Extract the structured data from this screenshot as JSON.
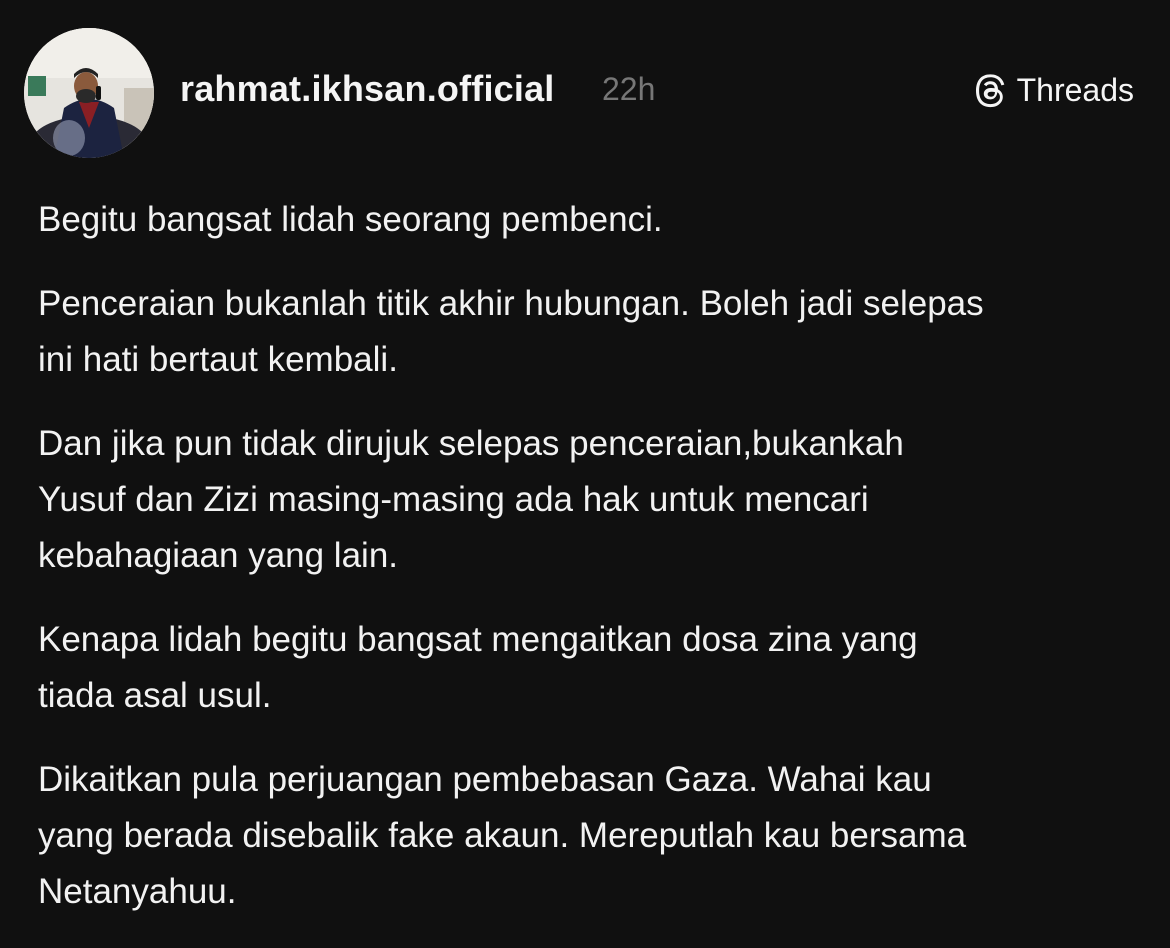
{
  "author": {
    "username": "rahmat.ikhsan.official",
    "timestamp": "22h",
    "avatar_alt": "avatar"
  },
  "platform": {
    "label": "Threads",
    "icon": "threads-logo-icon"
  },
  "post": {
    "paragraphs": [
      "Begitu bangsat lidah seorang pembenci.",
      "Penceraian bukanlah titik akhir hubungan. Boleh jadi selepas\nini hati bertaut kembali.",
      "Dan jika pun tidak dirujuk selepas penceraian,bukankah\nYusuf dan Zizi masing-masing ada hak untuk mencari\nkebahagiaan yang lain.",
      "Kenapa lidah begitu bangsat mengaitkan dosa zina yang\ntiada asal usul.",
      "Dikaitkan pula perjuangan pembebasan Gaza. Wahai kau\nyang berada disebalik fake akaun. Mereputlah kau bersama\nNetanyahuu."
    ]
  },
  "colors": {
    "background": "#101010",
    "text": "#f2f2f2",
    "muted": "#777777"
  }
}
